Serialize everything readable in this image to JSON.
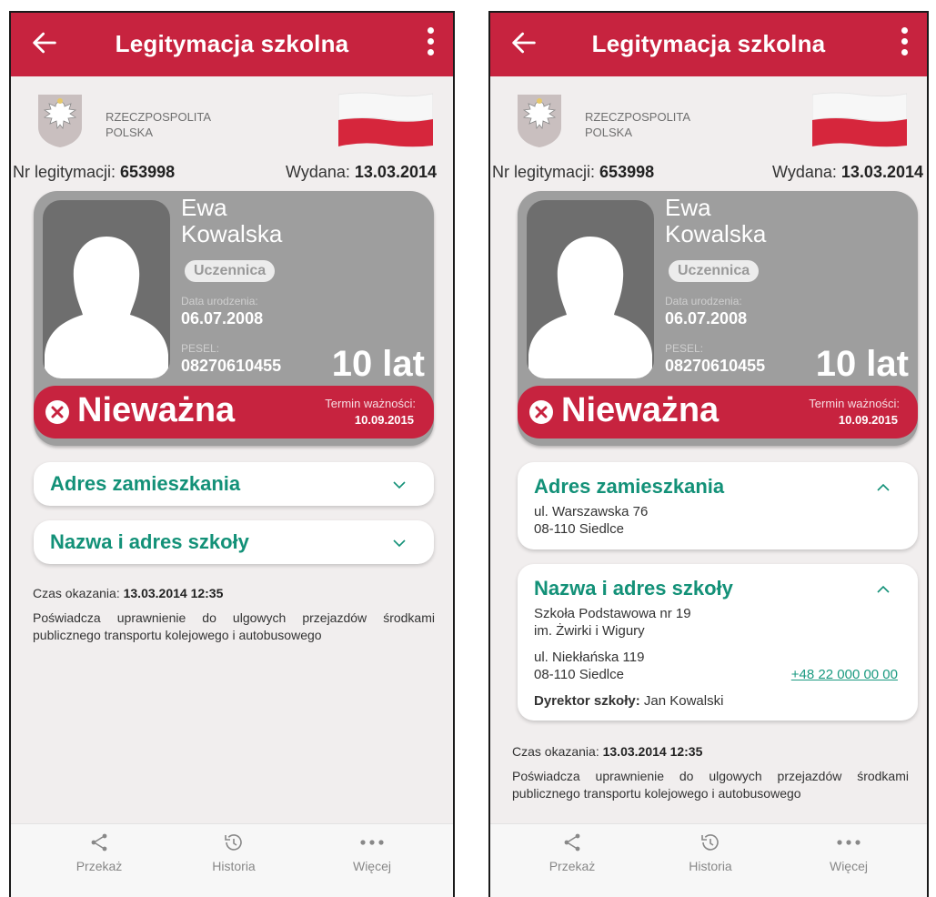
{
  "screens": [
    {
      "header": {
        "title": "Legitymacja szkolna"
      },
      "country": {
        "line1": "RZECZPOSPOLITA",
        "line2": "POLSKA"
      },
      "doc": {
        "nr_label": "Nr legitymacji:",
        "nr_value": "653998",
        "issued_label": "Wydana:",
        "issued_value": "13.03.2014"
      },
      "card": {
        "first_name": "Ewa",
        "last_name": "Kowalska",
        "role": "Uczennica",
        "dob_label": "Data urodzenia:",
        "dob_value": "06.07.2008",
        "pesel_label": "PESEL:",
        "pesel_value": "08270610455",
        "age": "10 lat",
        "status": "Nieważna",
        "term_label": "Termin ważności:",
        "term_value": "10.09.2015"
      },
      "address": {
        "title": "Adres zamieszkania"
      },
      "school": {
        "title": "Nazwa i adres szkoły"
      },
      "footer": {
        "shown_label": "Czas okazania:",
        "shown_value": "13.03.2014 12:35",
        "description": "Poświadcza uprawnienie do ulgowych przejazdów środkami publicznego transportu kolejowego i autobusowego"
      },
      "nav": {
        "share": "Przekaż",
        "history": "Historia",
        "more": "Więcej"
      }
    },
    {
      "header": {
        "title": "Legitymacja szkolna"
      },
      "country": {
        "line1": "RZECZPOSPOLITA",
        "line2": "POLSKA"
      },
      "doc": {
        "nr_label": "Nr legitymacji:",
        "nr_value": "653998",
        "issued_label": "Wydana:",
        "issued_value": "13.03.2014"
      },
      "card": {
        "first_name": "Ewa",
        "last_name": "Kowalska",
        "role": "Uczennica",
        "dob_label": "Data urodzenia:",
        "dob_value": "06.07.2008",
        "pesel_label": "PESEL:",
        "pesel_value": "08270610455",
        "age": "10 lat",
        "status": "Nieważna",
        "term_label": "Termin ważności:",
        "term_value": "10.09.2015"
      },
      "address": {
        "title": "Adres zamieszkania",
        "street": "ul. Warszawska 76",
        "city": "08-110 Siedlce"
      },
      "school": {
        "title": "Nazwa i adres szkoły",
        "name1": "Szkoła Podstawowa nr 19",
        "name2": "im. Żwirki i Wigury",
        "street": "ul. Niekłańska 119",
        "city": "08-110 Siedlce",
        "phone": "+48 22 000 00 00",
        "director_label": "Dyrektor szkoły:",
        "director_name": "Jan Kowalski"
      },
      "footer": {
        "shown_label": "Czas okazania:",
        "shown_value": "13.03.2014 12:35",
        "description": "Poświadcza uprawnienie do ulgowych przejazdów środkami publicznego transportu kolejowego i autobusowego"
      },
      "nav": {
        "share": "Przekaż",
        "history": "Historia",
        "more": "Więcej"
      }
    }
  ],
  "colors": {
    "brand_red": "#c7233f",
    "accent_green": "#139178",
    "card_gray": "#9e9e9e"
  }
}
